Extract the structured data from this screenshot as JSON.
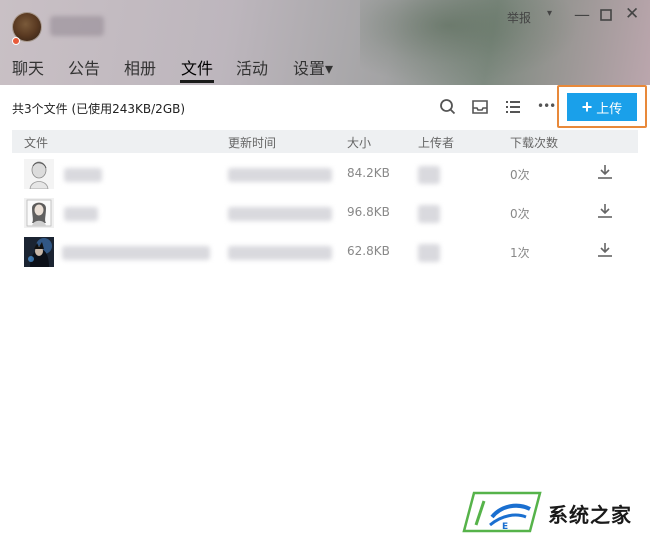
{
  "window": {
    "report_label": "举报",
    "caret": "▾",
    "min": "—",
    "max": "☐",
    "close": "✕"
  },
  "tabs": [
    {
      "label": "聊天"
    },
    {
      "label": "公告"
    },
    {
      "label": "相册"
    },
    {
      "label": "文件",
      "active": true
    },
    {
      "label": "活动"
    },
    {
      "label": "设置▾"
    }
  ],
  "toolbar": {
    "summary": "共3个文件 (已使用243KB/2GB)",
    "upload_label": "上传",
    "upload_plus": "+",
    "more": "•••"
  },
  "table": {
    "headers": [
      "文件",
      "更新时间",
      "大小",
      "上传者",
      "下载次数"
    ],
    "rows": [
      {
        "size": "84.2KB",
        "downloads": "0次"
      },
      {
        "size": "96.8KB",
        "downloads": "0次"
      },
      {
        "size": "62.8KB",
        "downloads": "1次"
      }
    ]
  },
  "watermark": {
    "text": "系统之家"
  },
  "colors": {
    "accent": "#1aa0ea",
    "highlight": "#e8893a"
  }
}
